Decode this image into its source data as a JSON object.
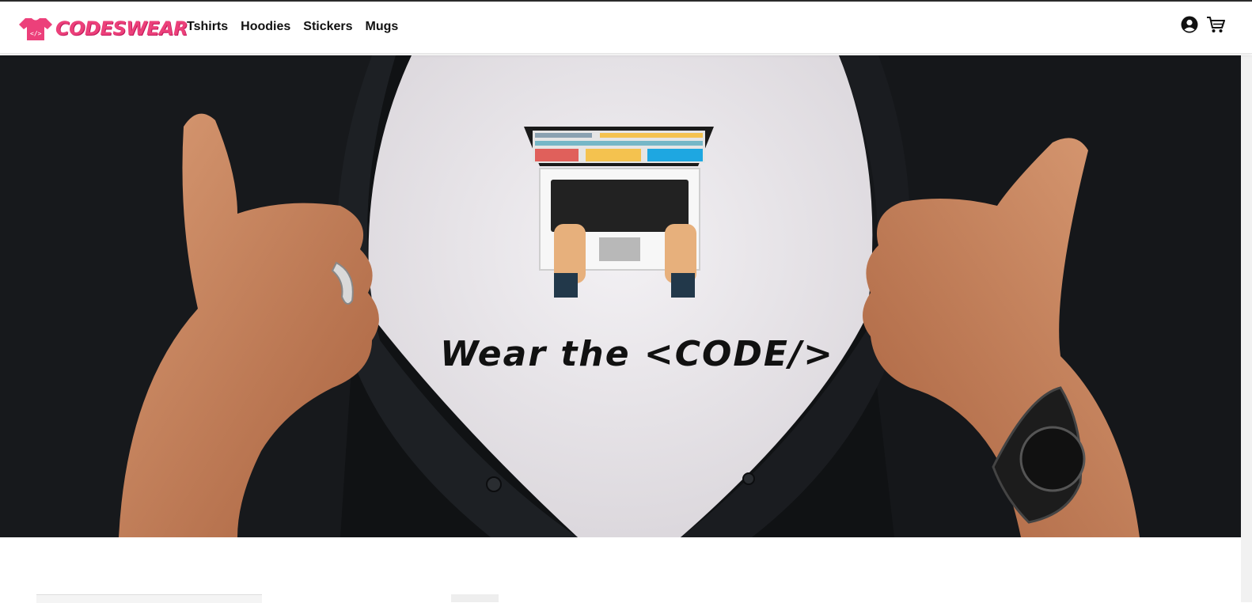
{
  "brand": {
    "name": "CODESWEAR",
    "logo_icon": "tshirt-code-icon",
    "color": "#ec407a"
  },
  "nav": {
    "links": [
      {
        "label": "Tshirts"
      },
      {
        "label": "Hoodies"
      },
      {
        "label": "Stickers"
      },
      {
        "label": "Mugs"
      }
    ],
    "icons": {
      "account": "user-circle-icon",
      "cart": "cart-icon"
    }
  },
  "hero": {
    "tagline": "Wear the <CODE/>",
    "image_subject": "hands-opening-shirt-with-laptop-tee"
  }
}
